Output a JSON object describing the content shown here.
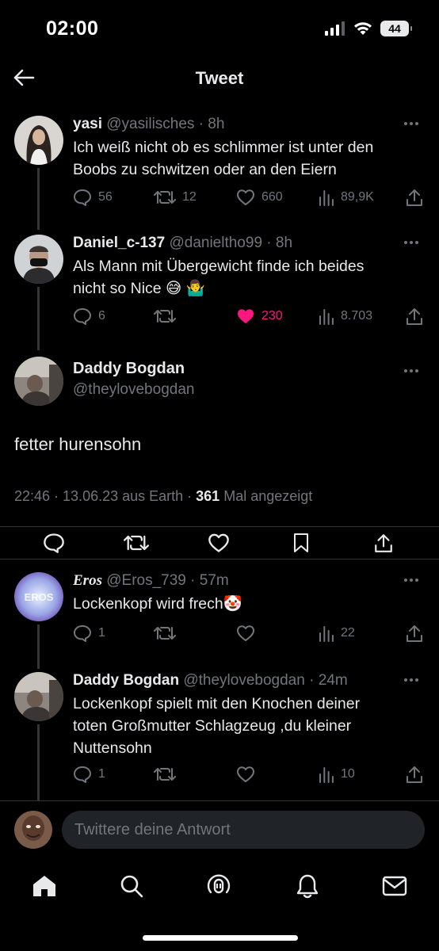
{
  "status_bar": {
    "time": "02:00",
    "battery": "44"
  },
  "header": {
    "title": "Tweet"
  },
  "tweets": [
    {
      "name": "yasi",
      "handle": "@yasilisches",
      "time": "· 8h",
      "text_lines": [
        "Ich weiß nicht ob es schlimmer ist unter den",
        "Boobs zu schwitzen oder an den Eiern"
      ],
      "replies": "56",
      "retweets": "12",
      "likes": "660",
      "views": "89,9K"
    },
    {
      "name": "Daniel_c-137",
      "handle": "@danieltho99",
      "time": "· 8h",
      "text_lines": [
        "Als Mann mit Übergewicht finde ich beides",
        "nicht so Nice 😅 🤷‍♂️"
      ],
      "replies": "6",
      "retweets": "",
      "likes": "230",
      "views": "8.703"
    }
  ],
  "main_tweet": {
    "name": "Daddy Bogdan",
    "handle": "@theylovebogdan",
    "text": "fetter hurensohn",
    "meta_prefix": "22:46 · 13.06.23 aus Earth · ",
    "views_count": "361",
    "views_suffix": " Mal angezeigt"
  },
  "replies_section": [
    {
      "name": "Eros",
      "handle": "@Eros_739",
      "time": "· 57m",
      "text_lines": [
        "Lockenkopf wird frech🤡"
      ],
      "replies": "1",
      "retweets": "",
      "likes": "",
      "views": "22"
    },
    {
      "name": "Daddy Bogdan",
      "handle": "@theylovebogdan",
      "time": "· 24m",
      "text_lines": [
        "Lockenkopf spielt mit den Knochen deiner",
        "toten Großmutter Schlagzeug ,du kleiner",
        "Nuttensohn"
      ],
      "replies": "1",
      "retweets": "",
      "likes": "",
      "views": "10"
    }
  ],
  "reply_bar": {
    "placeholder": "Twittere deine Antwort"
  },
  "colors": {
    "background": "#000000",
    "text": "#e7e9ea",
    "muted": "#71767b",
    "like": "#f91880",
    "divider": "#2f3336"
  },
  "tab_icons": [
    "home-icon",
    "search-icon",
    "spaces-icon",
    "notifications-icon",
    "messages-icon"
  ]
}
